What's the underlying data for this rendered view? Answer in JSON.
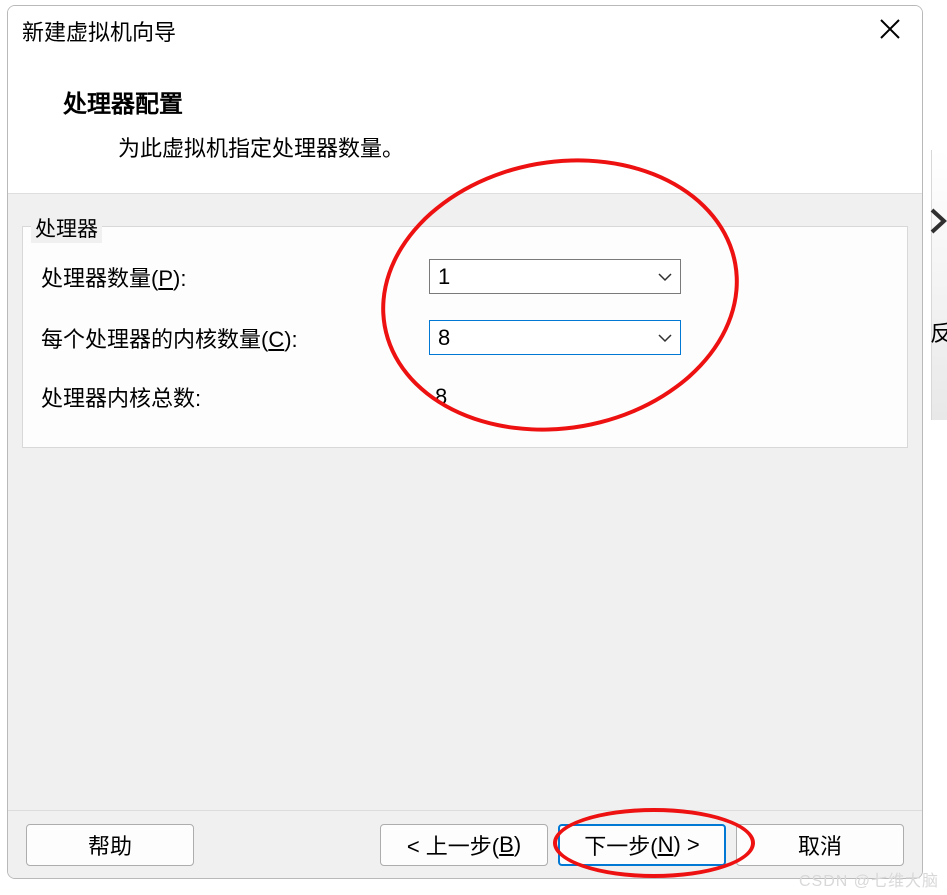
{
  "dialog": {
    "title": "新建虚拟机向导",
    "heading": "处理器配置",
    "subheading": "为此虚拟机指定处理器数量。"
  },
  "group": {
    "legend": "处理器",
    "rows": {
      "proc_count": {
        "label_pre": "处理器数量(",
        "label_key": "P",
        "label_post": "):",
        "value": "1"
      },
      "cores_per": {
        "label_pre": "每个处理器的内核数量(",
        "label_key": "C",
        "label_post": "):",
        "value": "8"
      },
      "total": {
        "label": "处理器内核总数:",
        "value": "8"
      }
    }
  },
  "buttons": {
    "help": "帮助",
    "back_pre": "< 上一步(",
    "back_key": "B",
    "back_post": ")",
    "next_pre": "下一步(",
    "next_key": "N",
    "next_post": ") >",
    "cancel": "取消"
  },
  "edge": {
    "glyph": "反"
  },
  "watermark": "CSDN @七维大脑"
}
